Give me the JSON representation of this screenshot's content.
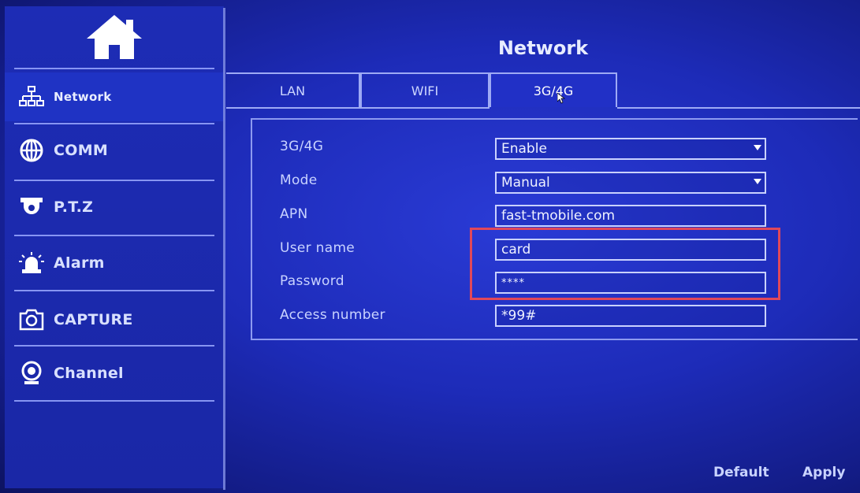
{
  "header": {
    "title": "Network"
  },
  "sidebar": {
    "items": [
      {
        "label": "Network",
        "icon": "network-icon"
      },
      {
        "label": "COMM",
        "icon": "globe-icon"
      },
      {
        "label": "P.T.Z",
        "icon": "dome-camera-icon"
      },
      {
        "label": "Alarm",
        "icon": "alarm-light-icon"
      },
      {
        "label": "CAPTURE",
        "icon": "camera-icon"
      },
      {
        "label": "Channel",
        "icon": "webcam-icon"
      }
    ]
  },
  "tabs": [
    {
      "label": "LAN"
    },
    {
      "label": "WIFI"
    },
    {
      "label": "3G/4G",
      "active": true
    }
  ],
  "form": {
    "rows": [
      {
        "label": "3G/4G",
        "value": "Enable",
        "type": "select"
      },
      {
        "label": "Mode",
        "value": "Manual",
        "type": "select"
      },
      {
        "label": "APN",
        "value": "fast-tmobile.com",
        "type": "text"
      },
      {
        "label": "User name",
        "value": "card",
        "type": "text"
      },
      {
        "label": "Password",
        "value": "****",
        "type": "password"
      },
      {
        "label": "Access number",
        "value": "*99#",
        "type": "text"
      }
    ]
  },
  "footer": {
    "default_label": "Default",
    "apply_label": "Apply"
  },
  "colors": {
    "accent": "#1d2bb8",
    "highlight": "#e0485a"
  }
}
